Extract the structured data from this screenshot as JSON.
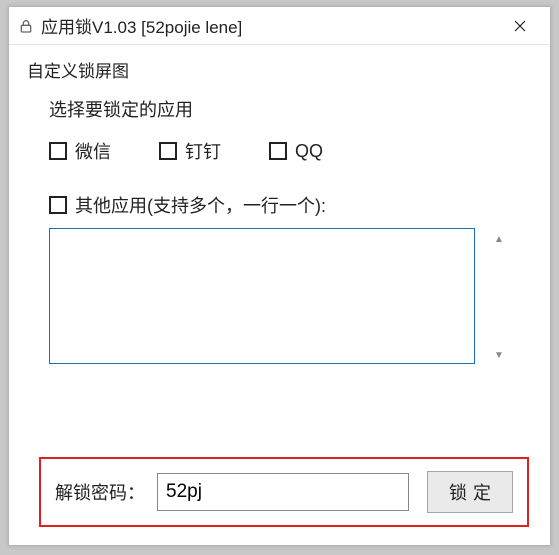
{
  "titlebar": {
    "title": "应用锁V1.03 [52pojie lene]"
  },
  "section": {
    "custom_lock_label": "自定义锁屏图",
    "select_apps_label": "选择要锁定的应用",
    "cb_wechat": "微信",
    "cb_dingding": "钉钉",
    "cb_qq": "QQ",
    "other_apps_label": "其他应用(支持多个，一行一个):"
  },
  "textarea": {
    "value": ""
  },
  "password": {
    "label": "解锁密码：",
    "value": "52pj",
    "lock_button": "锁定"
  }
}
